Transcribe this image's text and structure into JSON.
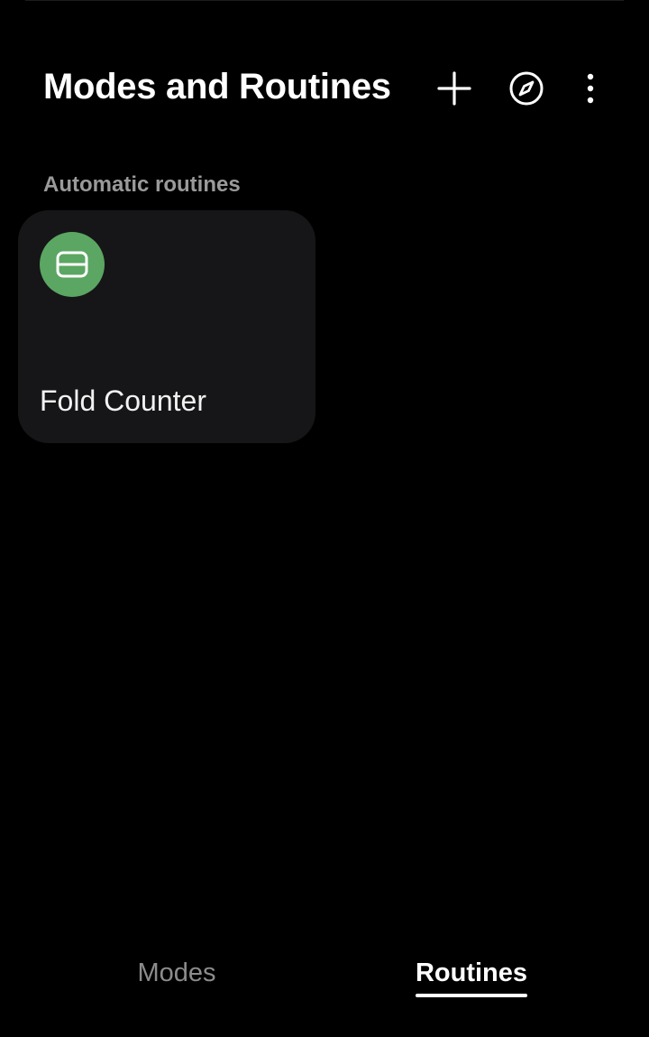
{
  "header": {
    "title": "Modes and Routines",
    "actions": [
      {
        "name": "add",
        "icon": "plus-icon"
      },
      {
        "name": "discover",
        "icon": "compass-icon"
      },
      {
        "name": "more_options",
        "icon": "more-vertical-icon"
      }
    ]
  },
  "sections": [
    {
      "title": "Automatic routines",
      "routines": [
        {
          "name": "Fold Counter",
          "icon": "fold-phone-icon",
          "icon_color": "#5ba662"
        }
      ]
    }
  ],
  "bottom_nav": {
    "tabs": [
      {
        "label": "Modes",
        "selected": false
      },
      {
        "label": "Routines",
        "selected": true
      }
    ]
  },
  "colors": {
    "background": "#000000",
    "card": "#161618",
    "accent_green": "#5ba662",
    "section_header": "#9a9a9a",
    "inactive_tab": "#8c8c8c"
  }
}
